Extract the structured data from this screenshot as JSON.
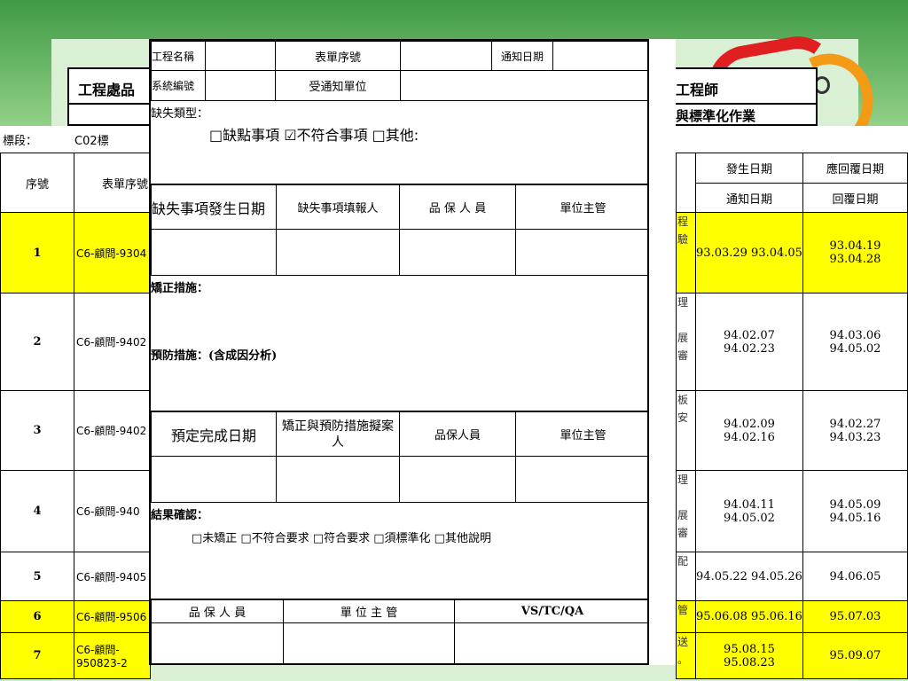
{
  "header": {
    "left_title": "工程處品",
    "right_title": "工程師",
    "right_sub": "與標準化作業"
  },
  "stage": {
    "label": "標段：",
    "value": "C02標"
  },
  "list": {
    "col_index": "序號",
    "col_form": "表單序號",
    "col_occur": "發生日期",
    "col_due": "應回覆日期",
    "col_notify": "通知日期",
    "col_reply": "回覆日期",
    "rows": [
      {
        "index": "1",
        "form": "C6-顧問-9304",
        "frag": "程\n驗",
        "dates": "93.03.29 93.04.05",
        "due": "93.04.19\n93.04.28"
      },
      {
        "index": "2",
        "form": "C6-顧問-9402",
        "frag": "理\n\n展\n審",
        "dates": "94.02.07\n94.02.23",
        "due": "94.03.06 94.05.02"
      },
      {
        "index": "3",
        "form": "C6-顧問-9402",
        "frag": "板\n安",
        "dates": "94.02.09\n94.02.16",
        "due": "94.02.27\n94.03.23"
      },
      {
        "index": "4",
        "form": "C6-顧問-940",
        "frag": "理\n\n展\n審",
        "dates": "94.04.11\n94.05.02",
        "due": "94.05.09\n94.05.16"
      },
      {
        "index": "5",
        "form": "C6-顧問-9405",
        "frag": "配",
        "dates": "94.05.22 94.05.26",
        "due": "94.06.05"
      },
      {
        "index": "6",
        "form": "C6-顧問-9506",
        "frag": "管",
        "dates": "95.06.08 95.06.16",
        "due": "95.07.03"
      },
      {
        "index": "7",
        "form": "C6-顧問-\n950823-2",
        "frag": "送\n。",
        "dates": "95.08.15\n95.08.23",
        "due": "95.09.07"
      }
    ]
  },
  "form": {
    "r1": [
      "工程名稱",
      "表單序號",
      "通知日期"
    ],
    "r2": [
      "系統編號",
      "受通知單位"
    ],
    "type_label": "缺失類型：",
    "type_options": "□缺點事項 ☑不符合事項 □其他:",
    "sig1": [
      "缺失事項發生日期",
      "缺失事項填報人",
      "品 保 人 員",
      "單位主管"
    ],
    "correct_label": "矯正措施：",
    "prevent_label": "預防措施：(含成因分析)",
    "sig2": [
      "預定完成日期",
      "矯正與預防措施擬案人",
      "品保人員",
      "單位主管"
    ],
    "result_label": "結果確認：",
    "result_options": "□未矯正 □不符合要求 □符合要求 □須標準化 □其他說明",
    "sig3": [
      "品 保 人 員",
      "單 位 主 管",
      "VS/TC/QA"
    ]
  }
}
